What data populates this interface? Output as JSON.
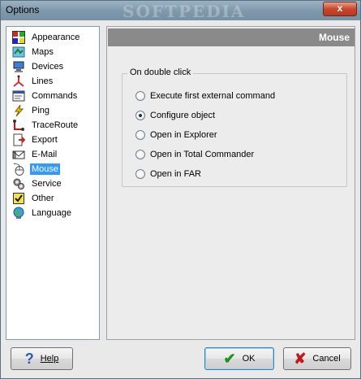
{
  "window": {
    "title": "Options",
    "watermark": "SOFTPEDIA",
    "close_glyph": "x"
  },
  "nav": {
    "items": [
      {
        "label": "Appearance",
        "icon": "appearance-icon"
      },
      {
        "label": "Maps",
        "icon": "maps-icon"
      },
      {
        "label": "Devices",
        "icon": "devices-icon"
      },
      {
        "label": "Lines",
        "icon": "lines-icon"
      },
      {
        "label": "Commands",
        "icon": "commands-icon"
      },
      {
        "label": "Ping",
        "icon": "ping-icon"
      },
      {
        "label": "TraceRoute",
        "icon": "traceroute-icon"
      },
      {
        "label": "Export",
        "icon": "export-icon"
      },
      {
        "label": "E-Mail",
        "icon": "email-icon"
      },
      {
        "label": "Mouse",
        "icon": "mouse-icon",
        "selected": true
      },
      {
        "label": "Service",
        "icon": "service-icon"
      },
      {
        "label": "Other",
        "icon": "other-icon"
      },
      {
        "label": "Language",
        "icon": "language-icon"
      }
    ]
  },
  "panel": {
    "title": "Mouse",
    "group_label": "On double click",
    "options": [
      {
        "label": "Execute first external command",
        "checked": false
      },
      {
        "label": "Configure object",
        "checked": true
      },
      {
        "label": "Open in Explorer",
        "checked": false
      },
      {
        "label": "Open in Total Commander",
        "checked": false
      },
      {
        "label": "Open in FAR",
        "checked": false
      }
    ]
  },
  "buttons": {
    "help": {
      "label": "Help",
      "glyph": "?"
    },
    "ok": {
      "label": "OK",
      "glyph": "✔"
    },
    "cancel": {
      "label": "Cancel",
      "glyph": "✘"
    }
  },
  "colors": {
    "selection": "#3399ff",
    "header": "#8a8a8a",
    "ok_check": "#1f8f1f",
    "cancel_x": "#c0181b",
    "help_q": "#2a5db0"
  }
}
